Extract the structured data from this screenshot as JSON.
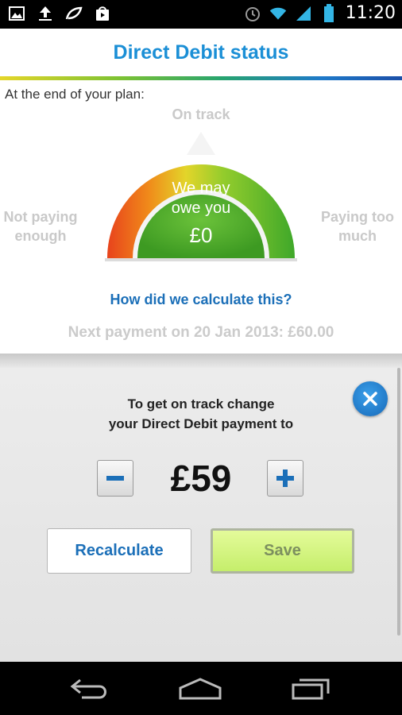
{
  "status_bar": {
    "time": "11:20",
    "left_icons": [
      "image-icon",
      "upload-icon",
      "leaf-icon",
      "store-icon"
    ],
    "right_icons": [
      "alarm-icon",
      "wifi-icon",
      "signal-icon",
      "battery-icon"
    ]
  },
  "header": {
    "title": "Direct Debit status"
  },
  "plan": {
    "end_label": "At the end of your plan:",
    "gauge": {
      "top_label": "On track",
      "left_label_line1": "Not paying",
      "left_label_line2": "enough",
      "right_label_line1": "Paying too",
      "right_label_line2": "much",
      "center_line1": "We may",
      "center_line2": "owe you",
      "center_amount": "£0"
    },
    "calc_link": "How did we calculate this?",
    "next_payment": "Next payment on 20 Jan 2013: £60.00"
  },
  "adjust": {
    "prompt_line1": "To get on track change",
    "prompt_line2": "your Direct Debit payment to",
    "amount": "£59",
    "minus_label": "−",
    "plus_label": "+",
    "recalculate_label": "Recalculate",
    "save_label": "Save"
  },
  "colors": {
    "accent": "#1b8fd6",
    "link": "#1b6fb8",
    "gauge_center": "#4aa72a",
    "save_bg": "#d4f47e"
  }
}
